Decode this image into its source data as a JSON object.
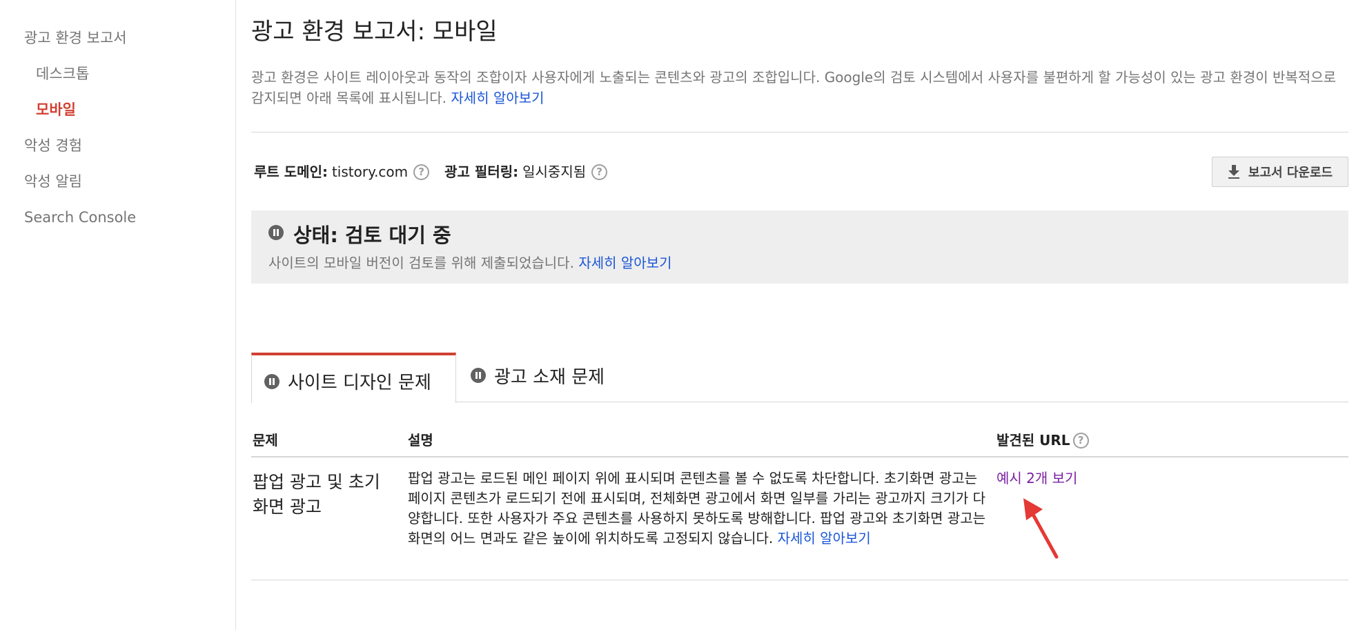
{
  "sidebar": {
    "items": [
      {
        "label": "광고 환경 보고서"
      },
      {
        "label": "데스크톱"
      },
      {
        "label": "모바일"
      },
      {
        "label": "악성 경험"
      },
      {
        "label": "악성 알림"
      },
      {
        "label": "Search Console"
      }
    ]
  },
  "page": {
    "title": "광고 환경 보고서: 모바일",
    "intro": "광고 환경은 사이트 레이아웃과 동작의 조합이자 사용자에게 노출되는 콘텐츠와 광고의 조합입니다. Google의 검토 시스템에서 사용자를 불편하게 할 가능성이 있는 광고 환경이 반복적으로 감지되면 아래 목록에 표시됩니다.",
    "intro_link": "자세히 알아보기"
  },
  "meta": {
    "root_domain_label": "루트 도메인:",
    "root_domain_value": "tistory.com",
    "ad_filtering_label": "광고 필터링:",
    "ad_filtering_value": "일시중지됨",
    "help_glyph": "?",
    "download_label": "보고서 다운로드"
  },
  "status": {
    "title": "상태: 검토 대기 중",
    "description": "사이트의 모바일 버전이 검토를 위해 제출되었습니다.",
    "link": "자세히 알아보기"
  },
  "tabs": [
    {
      "label": "사이트 디자인 문제",
      "active": true
    },
    {
      "label": "광고 소재 문제",
      "active": false
    }
  ],
  "table": {
    "headers": {
      "issue": "문제",
      "description": "설명",
      "urls": "발견된 URL"
    },
    "rows": [
      {
        "issue": "팝업 광고 및 초기화면 광고",
        "description": "팝업 광고는 로드된 메인 페이지 위에 표시되며 콘텐츠를 볼 수 없도록 차단합니다. 초기화면 광고는 페이지 콘텐츠가 로드되기 전에 표시되며, 전체화면 광고에서 화면 일부를 가리는 광고까지 크기가 다양합니다. 또한 사용자가 주요 콘텐츠를 사용하지 못하도록 방해합니다. 팝업 광고와 초기화면 광고는 화면의 어느 면과도 같은 높이에 위치하도록 고정되지 않습니다.",
        "description_link": "자세히 알아보기",
        "urls_link": "예시 2개 보기"
      }
    ]
  },
  "colors": {
    "active_accent": "#d23f31",
    "link": "#1a55d6",
    "visited_link": "#7b1fa2",
    "annotation_arrow": "#e53935"
  }
}
